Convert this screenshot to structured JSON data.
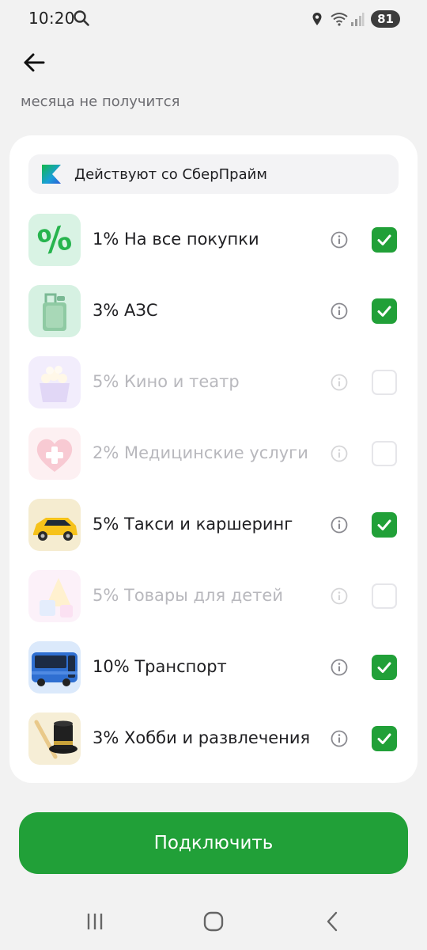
{
  "status_bar": {
    "time": "10:20",
    "battery": "81"
  },
  "header": {
    "subtitle": "месяца не получится"
  },
  "banner": {
    "text": "Действуют со СберПрайм"
  },
  "categories": [
    {
      "label": "1% На все покупки",
      "checked": true,
      "enabled": true,
      "icon": "percent-icon"
    },
    {
      "label": "3% АЗС",
      "checked": true,
      "enabled": true,
      "icon": "fuel-canister-icon"
    },
    {
      "label": "5% Кино и театр",
      "checked": false,
      "enabled": false,
      "icon": "popcorn-icon"
    },
    {
      "label": "2% Медицинские услуги",
      "checked": false,
      "enabled": false,
      "icon": "medical-heart-icon"
    },
    {
      "label": "5% Такси и каршеринг",
      "checked": true,
      "enabled": true,
      "icon": "taxi-car-icon"
    },
    {
      "label": "5% Товары для детей",
      "checked": false,
      "enabled": false,
      "icon": "toy-blocks-icon"
    },
    {
      "label": "10% Транспорт",
      "checked": true,
      "enabled": true,
      "icon": "bus-icon"
    },
    {
      "label": "3% Хобби и развлечения",
      "checked": true,
      "enabled": true,
      "icon": "magic-hat-icon"
    }
  ],
  "connect_button": {
    "label": "Подключить"
  },
  "colors": {
    "accent": "#21a038",
    "background": "#f2f2f2",
    "card": "#ffffff"
  }
}
